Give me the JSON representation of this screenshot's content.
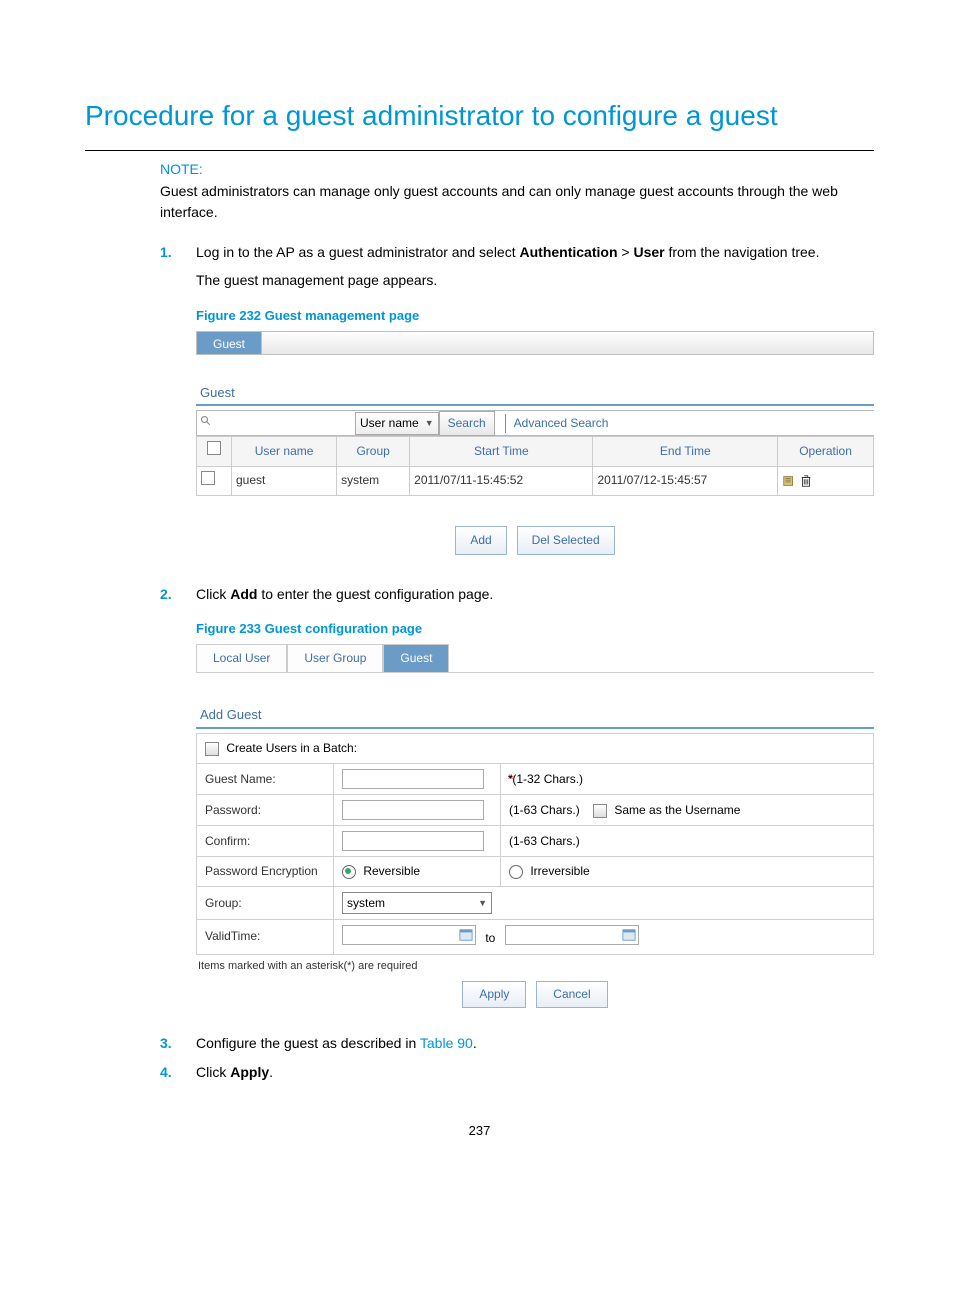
{
  "title": "Procedure for a guest administrator to configure a guest",
  "note_label": "NOTE:",
  "note_text": "Guest administrators can manage only guest accounts and can only manage guest accounts through the web interface.",
  "steps": {
    "s1a": "Log in to the AP as a guest administrator and select ",
    "s1b": "Authentication",
    "s1c": " > ",
    "s1d": "User",
    "s1e": " from the navigation tree.",
    "s1f": "The guest management page appears.",
    "s2a": "Click ",
    "s2b": "Add",
    "s2c": " to enter the guest configuration page.",
    "s3a": "Configure the guest as described in ",
    "s3b": "Table 90",
    "s3c": ".",
    "s4a": "Click ",
    "s4b": "Apply",
    "s4c": "."
  },
  "fig232": {
    "caption": "Figure 232 Guest management page",
    "tab": "Guest",
    "section": "Guest",
    "search_field_sel": "User name",
    "search_btn": "Search",
    "adv_search": "Advanced Search",
    "cols": {
      "c1": "User name",
      "c2": "Group",
      "c3": "Start Time",
      "c4": "End Time",
      "c5": "Operation"
    },
    "row": {
      "user": "guest",
      "group": "system",
      "start": "2011/07/11-15:45:52",
      "end": "2011/07/12-15:45:57"
    },
    "add_btn": "Add",
    "del_btn": "Del Selected"
  },
  "fig233": {
    "caption": "Figure 233 Guest configuration page",
    "tabs": {
      "t1": "Local User",
      "t2": "User Group",
      "t3": "Guest"
    },
    "section": "Add Guest",
    "batch": "Create Users in a Batch:",
    "guest_name": "Guest Name:",
    "guest_name_hint": "*(1-32 Chars.)",
    "password": "Password:",
    "password_hint": "(1-63 Chars.)",
    "same_user": "Same as the Username",
    "confirm": "Confirm:",
    "confirm_hint": "(1-63 Chars.)",
    "enc": "Password Encryption",
    "enc_rev": "Reversible",
    "enc_irrev": "Irreversible",
    "group": "Group:",
    "group_val": "system",
    "valid": "ValidTime:",
    "to": "to",
    "req": "Items marked with an asterisk(*) are required",
    "apply": "Apply",
    "cancel": "Cancel"
  },
  "page_num": "237"
}
